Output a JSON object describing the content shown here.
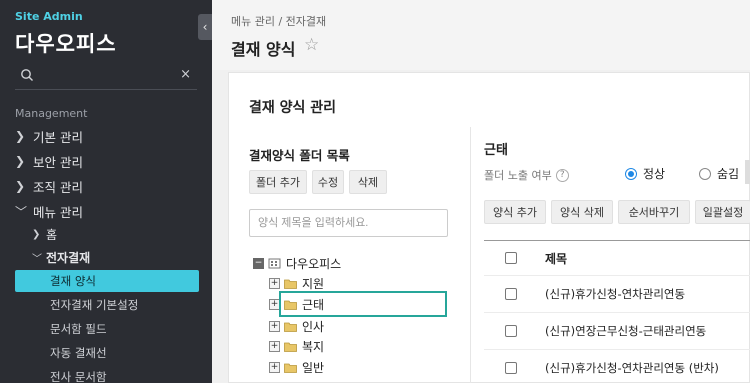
{
  "sidebar": {
    "brand_small": "Site Admin",
    "brand_name": "다우오피스",
    "collapse_icon": "‹",
    "search": {
      "placeholder": "",
      "clear_icon": "×"
    },
    "section_label": "Management",
    "menus": [
      {
        "label": "기본 관리",
        "state": "collapsed"
      },
      {
        "label": "보안 관리",
        "state": "collapsed"
      },
      {
        "label": "조직 관리",
        "state": "collapsed"
      },
      {
        "label": "메뉴 관리",
        "state": "expanded"
      }
    ],
    "submenus": [
      {
        "label": "홈",
        "state": "collapsed"
      },
      {
        "label": "전자결재",
        "state": "expanded"
      }
    ],
    "leaves": [
      "결재 양식",
      "전자결재 기본설정",
      "문서함 필드",
      "자동 결재선",
      "전사 문서함"
    ],
    "active_leaf": "결재 양식",
    "colors": {
      "bg": "#2b2d33",
      "accent": "#41c9de",
      "brand": "#4fd1e5"
    }
  },
  "header": {
    "breadcrumb": "메뉴 관리 / 전자결재",
    "title": "결재 양식",
    "star_icon": "☆"
  },
  "card": {
    "title": "결재 양식 관리",
    "left": {
      "title": "결재양식 폴더 목록",
      "buttons": [
        "폴더 추가",
        "수정",
        "삭제"
      ],
      "search_placeholder": "양식 제목을 입력하세요.",
      "tree": [
        {
          "label": "다우오피스",
          "level": 0,
          "expanded": true,
          "icon": "org-icon"
        },
        {
          "label": "지원",
          "level": 1
        },
        {
          "label": "근태",
          "level": 1,
          "selected": true
        },
        {
          "label": "인사",
          "level": 1
        },
        {
          "label": "복지",
          "level": 1
        },
        {
          "label": "일반",
          "level": 1
        }
      ]
    },
    "right": {
      "title": "근태",
      "expose_label": "폴더 노출 여부",
      "help_icon": "?",
      "radios": [
        {
          "label": "정상",
          "checked": true
        },
        {
          "label": "숨김",
          "checked": false
        }
      ],
      "buttons": [
        "양식 추가",
        "양식 삭제",
        "순서바꾸기",
        "일괄설정"
      ],
      "table_header": "제목",
      "rows": [
        "(신규)휴가신청-연차관리연동",
        "(신규)연장근무신청-근태관리연동",
        "(신규)휴가신청-연차관리연동 (반차)"
      ]
    },
    "colors": {
      "selected_border": "#26a69a",
      "radio_on": "#1e88e5"
    }
  }
}
